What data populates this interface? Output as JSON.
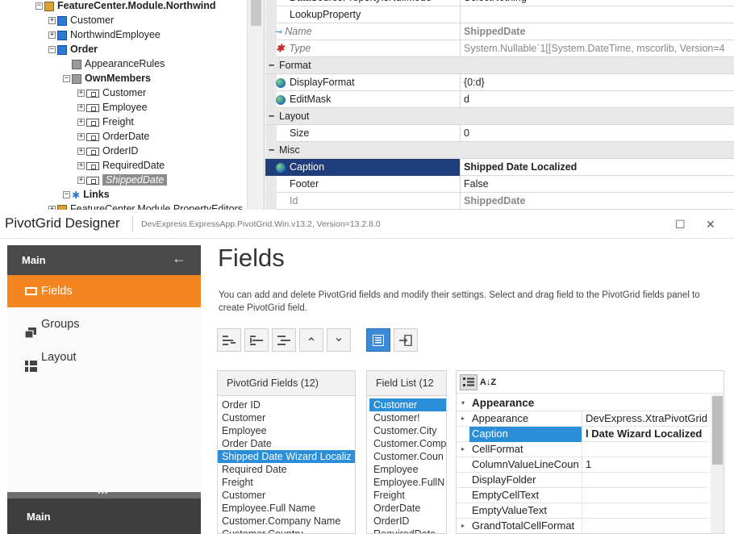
{
  "tree": {
    "nodes": [
      {
        "label": "FeatureCenter.Module.Northwind",
        "indent": 0,
        "icon": "module-icon",
        "bold": true
      },
      {
        "label": "Customer",
        "indent": 1,
        "icon": "class-icon"
      },
      {
        "label": "NorthwindEmployee",
        "indent": 1,
        "icon": "class-icon"
      },
      {
        "label": "Order",
        "indent": 1,
        "icon": "class-icon",
        "bold": true
      },
      {
        "label": "AppearanceRules",
        "indent": 2,
        "icon": "folder-icon"
      },
      {
        "label": "OwnMembers",
        "indent": 2,
        "icon": "folder-icon",
        "bold": true
      },
      {
        "label": "Customer",
        "indent": 3,
        "icon": "property-icon"
      },
      {
        "label": "Employee",
        "indent": 3,
        "icon": "property-icon"
      },
      {
        "label": "Freight",
        "indent": 3,
        "icon": "property-icon"
      },
      {
        "label": "OrderDate",
        "indent": 3,
        "icon": "property-icon"
      },
      {
        "label": "OrderID",
        "indent": 3,
        "icon": "property-icon"
      },
      {
        "label": "RequiredDate",
        "indent": 3,
        "icon": "property-icon"
      },
      {
        "label": "ShippedDate",
        "indent": 3,
        "icon": "property-icon",
        "selected": true
      },
      {
        "label": "Links",
        "indent": 2,
        "icon": "link-icon",
        "bold": true
      },
      {
        "label": "FeatureCenter.Module.PropertyEditors",
        "indent": 1,
        "icon": "module-icon"
      }
    ]
  },
  "top_grid": {
    "rows": [
      {
        "type": "prop",
        "name": "DataSourcePropertyIsNullMode",
        "value": "SelectNothing"
      },
      {
        "type": "prop",
        "name": "LookupProperty",
        "value": ""
      },
      {
        "type": "key",
        "name": "Name",
        "value": "ShippedDate"
      },
      {
        "type": "type",
        "name": "Type",
        "value": "System.Nullable`1[[System.DateTime, mscorlib, Version=4"
      },
      {
        "type": "cat",
        "name": "Format"
      },
      {
        "type": "globe",
        "name": "DisplayFormat",
        "value": "{0:d}"
      },
      {
        "type": "globe",
        "name": "EditMask",
        "value": "d"
      },
      {
        "type": "cat",
        "name": "Layout"
      },
      {
        "type": "prop",
        "name": "Size",
        "value": "0"
      },
      {
        "type": "cat",
        "name": "Misc"
      },
      {
        "type": "globe",
        "name": "Caption",
        "value": "Shipped Date Localized",
        "selected": true
      },
      {
        "type": "prop",
        "name": "Footer",
        "value": "False"
      },
      {
        "type": "grayprop",
        "name": "Id",
        "value": "ShippedDate"
      }
    ]
  },
  "designer": {
    "title": "PivotGrid Designer",
    "subtitle": "DevExpress.ExpressApp.PivotGrid.Win.v13.2, Version=13.2.8.0",
    "maximize_glyph": "☐",
    "close_glyph": "✕",
    "sidebar": {
      "header": "Main",
      "back_glyph": "←",
      "items": [
        {
          "label": "Fields",
          "active": true
        },
        {
          "label": "Groups"
        },
        {
          "label": "Layout"
        }
      ],
      "footer": "Main"
    },
    "heading": "Fields",
    "description": "You can add and delete PivotGrid fields and modify their settings. Select and drag field to the PivotGrid fields panel to create PivotGrid field.",
    "toolbar_glyphs": {
      "up": "⌃",
      "down": "⌄"
    },
    "pivot_fields": {
      "header": "PivotGrid Fields (12)",
      "items": [
        "Order ID",
        "Customer",
        "Employee",
        "Order Date",
        "Shipped Date Wizard Localiz",
        "Required Date",
        "Freight",
        "Customer",
        "Employee.Full Name",
        "Customer.Company Name",
        "Customer.Country"
      ],
      "selected_index": 4
    },
    "field_list": {
      "header": "Field List (12",
      "items": [
        "Customer",
        "Customer!",
        "Customer.City",
        "Customer.Comp",
        "Customer.Coun",
        "Employee",
        "Employee.FullN",
        "Freight",
        "OrderDate",
        "OrderID",
        "RequiredDate"
      ],
      "selected_index": 0
    },
    "props": {
      "sort_glyph": "A↓Z",
      "rows": [
        {
          "type": "cat",
          "name": "Appearance"
        },
        {
          "name": "Appearance",
          "value": "DevExpress.XtraPivotGrid.F",
          "expandable": true
        },
        {
          "name": "Caption",
          "value": "l Date Wizard Localized",
          "selected": true
        },
        {
          "name": "CellFormat",
          "value": "",
          "expandable": true
        },
        {
          "name": "ColumnValueLineCoun",
          "value": "1"
        },
        {
          "name": "DisplayFolder",
          "value": ""
        },
        {
          "name": "EmptyCellText",
          "value": ""
        },
        {
          "name": "EmptyValueText",
          "value": ""
        },
        {
          "name": "GrandTotalCellFormat",
          "value": "",
          "expandable": true
        }
      ]
    }
  },
  "colors": {
    "accent_orange": "#f5851f",
    "selection_blue": "#2b8ed8",
    "grid_selection_navy": "#1e3d7a",
    "sidebar_dark": "#4a4a4a"
  }
}
